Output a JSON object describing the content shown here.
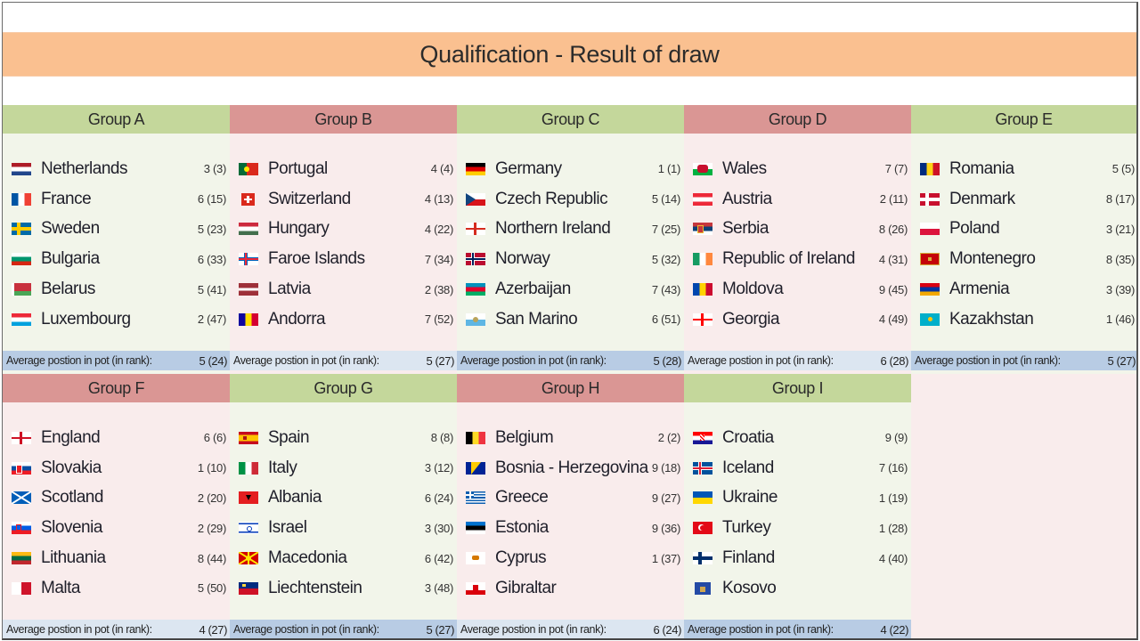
{
  "title": "Qualification - Result of draw",
  "avg_label": "Average postion in pot (in rank):",
  "colors": {
    "title_bg": "#fac090",
    "green_header": "#c4d79b",
    "red_header": "#da9694",
    "green_body": "#f2f5ea",
    "red_body": "#f9ecec",
    "avg_green": "#b8cce4",
    "avg_red": "#dce6f1"
  },
  "groups": [
    {
      "name": "Group A",
      "theme": "green",
      "average": "5 (24)",
      "teams": [
        {
          "name": "Netherlands",
          "flag": "netherlands-flag-icon",
          "rank": "3 (3)"
        },
        {
          "name": "France",
          "flag": "france-flag-icon",
          "rank": "6 (15)"
        },
        {
          "name": "Sweden",
          "flag": "sweden-flag-icon",
          "rank": "5 (23)"
        },
        {
          "name": "Bulgaria",
          "flag": "bulgaria-flag-icon",
          "rank": "6 (33)"
        },
        {
          "name": "Belarus",
          "flag": "belarus-flag-icon",
          "rank": "5 (41)"
        },
        {
          "name": "Luxembourg",
          "flag": "luxembourg-flag-icon",
          "rank": "2 (47)"
        }
      ]
    },
    {
      "name": "Group B",
      "theme": "red",
      "average": "5 (27)",
      "teams": [
        {
          "name": "Portugal",
          "flag": "portugal-flag-icon",
          "rank": "4 (4)"
        },
        {
          "name": "Switzerland",
          "flag": "switzerland-flag-icon",
          "rank": "4 (13)"
        },
        {
          "name": "Hungary",
          "flag": "hungary-flag-icon",
          "rank": "4 (22)"
        },
        {
          "name": "Faroe Islands",
          "flag": "faroe-islands-flag-icon",
          "rank": "7 (34)"
        },
        {
          "name": "Latvia",
          "flag": "latvia-flag-icon",
          "rank": "2 (38)"
        },
        {
          "name": "Andorra",
          "flag": "andorra-flag-icon",
          "rank": "7 (52)"
        }
      ]
    },
    {
      "name": "Group C",
      "theme": "green",
      "average": "5 (28)",
      "teams": [
        {
          "name": "Germany",
          "flag": "germany-flag-icon",
          "rank": "1 (1)"
        },
        {
          "name": "Czech Republic",
          "flag": "czech-republic-flag-icon",
          "rank": "5 (14)"
        },
        {
          "name": "Northern Ireland",
          "flag": "northern-ireland-flag-icon",
          "rank": "7 (25)"
        },
        {
          "name": "Norway",
          "flag": "norway-flag-icon",
          "rank": "5 (32)"
        },
        {
          "name": "Azerbaijan",
          "flag": "azerbaijan-flag-icon",
          "rank": "7 (43)"
        },
        {
          "name": "San Marino",
          "flag": "san-marino-flag-icon",
          "rank": "6 (51)"
        }
      ]
    },
    {
      "name": "Group D",
      "theme": "red",
      "average": "6 (28)",
      "teams": [
        {
          "name": "Wales",
          "flag": "wales-flag-icon",
          "rank": "7 (7)"
        },
        {
          "name": "Austria",
          "flag": "austria-flag-icon",
          "rank": "2 (11)"
        },
        {
          "name": "Serbia",
          "flag": "serbia-flag-icon",
          "rank": "8 (26)"
        },
        {
          "name": "Republic of Ireland",
          "flag": "ireland-flag-icon",
          "rank": "4 (31)"
        },
        {
          "name": "Moldova",
          "flag": "moldova-flag-icon",
          "rank": "9 (45)"
        },
        {
          "name": "Georgia",
          "flag": "georgia-flag-icon",
          "rank": "4 (49)"
        }
      ]
    },
    {
      "name": "Group E",
      "theme": "green",
      "average": "5 (27)",
      "teams": [
        {
          "name": "Romania",
          "flag": "romania-flag-icon",
          "rank": "5 (5)"
        },
        {
          "name": "Denmark",
          "flag": "denmark-flag-icon",
          "rank": "8 (17)"
        },
        {
          "name": "Poland",
          "flag": "poland-flag-icon",
          "rank": "3 (21)"
        },
        {
          "name": "Montenegro",
          "flag": "montenegro-flag-icon",
          "rank": "8 (35)"
        },
        {
          "name": "Armenia",
          "flag": "armenia-flag-icon",
          "rank": "3 (39)"
        },
        {
          "name": "Kazakhstan",
          "flag": "kazakhstan-flag-icon",
          "rank": "1 (46)"
        }
      ]
    },
    {
      "name": "Group F",
      "theme": "red",
      "average": "4 (27)",
      "teams": [
        {
          "name": "England",
          "flag": "england-flag-icon",
          "rank": "6 (6)"
        },
        {
          "name": "Slovakia",
          "flag": "slovakia-flag-icon",
          "rank": "1 (10)"
        },
        {
          "name": "Scotland",
          "flag": "scotland-flag-icon",
          "rank": "2 (20)"
        },
        {
          "name": "Slovenia",
          "flag": "slovenia-flag-icon",
          "rank": "2 (29)"
        },
        {
          "name": "Lithuania",
          "flag": "lithuania-flag-icon",
          "rank": "8 (44)"
        },
        {
          "name": "Malta",
          "flag": "malta-flag-icon",
          "rank": "5 (50)"
        }
      ]
    },
    {
      "name": "Group G",
      "theme": "green",
      "average": "5 (27)",
      "teams": [
        {
          "name": "Spain",
          "flag": "spain-flag-icon",
          "rank": "8 (8)"
        },
        {
          "name": "Italy",
          "flag": "italy-flag-icon",
          "rank": "3 (12)"
        },
        {
          "name": "Albania",
          "flag": "albania-flag-icon",
          "rank": "6 (24)"
        },
        {
          "name": "Israel",
          "flag": "israel-flag-icon",
          "rank": "3 (30)"
        },
        {
          "name": "Macedonia",
          "flag": "macedonia-flag-icon",
          "rank": "6 (42)"
        },
        {
          "name": "Liechtenstein",
          "flag": "liechtenstein-flag-icon",
          "rank": "3 (48)"
        }
      ]
    },
    {
      "name": "Group H",
      "theme": "red",
      "average": "6 (24)",
      "teams": [
        {
          "name": "Belgium",
          "flag": "belgium-flag-icon",
          "rank": "2 (2)"
        },
        {
          "name": "Bosnia - Herzegovina",
          "flag": "bosnia-herzegovina-flag-icon",
          "rank": "9 (18)"
        },
        {
          "name": "Greece",
          "flag": "greece-flag-icon",
          "rank": "9 (27)"
        },
        {
          "name": "Estonia",
          "flag": "estonia-flag-icon",
          "rank": "9 (36)"
        },
        {
          "name": "Cyprus",
          "flag": "cyprus-flag-icon",
          "rank": "1 (37)"
        },
        {
          "name": "Gibraltar",
          "flag": "gibraltar-flag-icon",
          "rank": ""
        }
      ]
    },
    {
      "name": "Group I",
      "theme": "green",
      "average": "4 (22)",
      "teams": [
        {
          "name": "Croatia",
          "flag": "croatia-flag-icon",
          "rank": "9 (9)"
        },
        {
          "name": "Iceland",
          "flag": "iceland-flag-icon",
          "rank": "7 (16)"
        },
        {
          "name": "Ukraine",
          "flag": "ukraine-flag-icon",
          "rank": "1 (19)"
        },
        {
          "name": "Turkey",
          "flag": "turkey-flag-icon",
          "rank": "1 (28)"
        },
        {
          "name": "Finland",
          "flag": "finland-flag-icon",
          "rank": "4 (40)"
        },
        {
          "name": "Kosovo",
          "flag": "kosovo-flag-icon",
          "rank": ""
        }
      ]
    }
  ]
}
